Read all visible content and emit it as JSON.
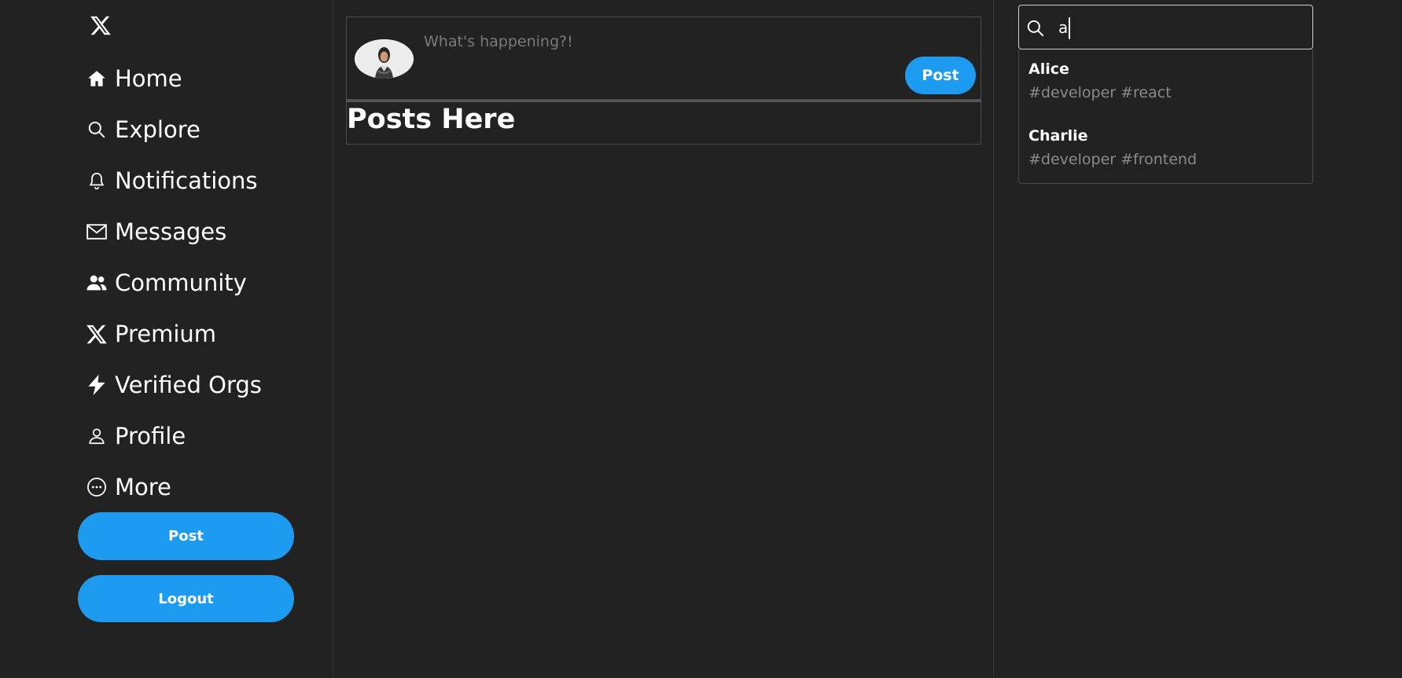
{
  "sidebar": {
    "logo_icon": "x-logo-icon",
    "items": [
      {
        "label": "Home",
        "icon": "home-icon"
      },
      {
        "label": "Explore",
        "icon": "search-icon"
      },
      {
        "label": "Notifications",
        "icon": "bell-icon"
      },
      {
        "label": "Messages",
        "icon": "envelope-icon"
      },
      {
        "label": "Community",
        "icon": "people-icon"
      },
      {
        "label": "Premium",
        "icon": "x-logo-icon"
      },
      {
        "label": "Verified Orgs",
        "icon": "lightning-icon"
      },
      {
        "label": "Profile",
        "icon": "person-icon"
      },
      {
        "label": "More",
        "icon": "more-circle-icon"
      }
    ],
    "post_label": "Post",
    "logout_label": "Logout"
  },
  "composer": {
    "placeholder": "What's happening?!",
    "post_label": "Post"
  },
  "feed": {
    "heading": "Posts Here"
  },
  "search": {
    "value": "a",
    "results": [
      {
        "name": "Alice",
        "tags": "#developer #react"
      },
      {
        "name": "Charlie",
        "tags": "#developer #frontend"
      }
    ]
  },
  "colors": {
    "background": "#222222",
    "accent": "#1d9bf0",
    "text": "#ffffff",
    "muted": "#8a8a8a"
  }
}
